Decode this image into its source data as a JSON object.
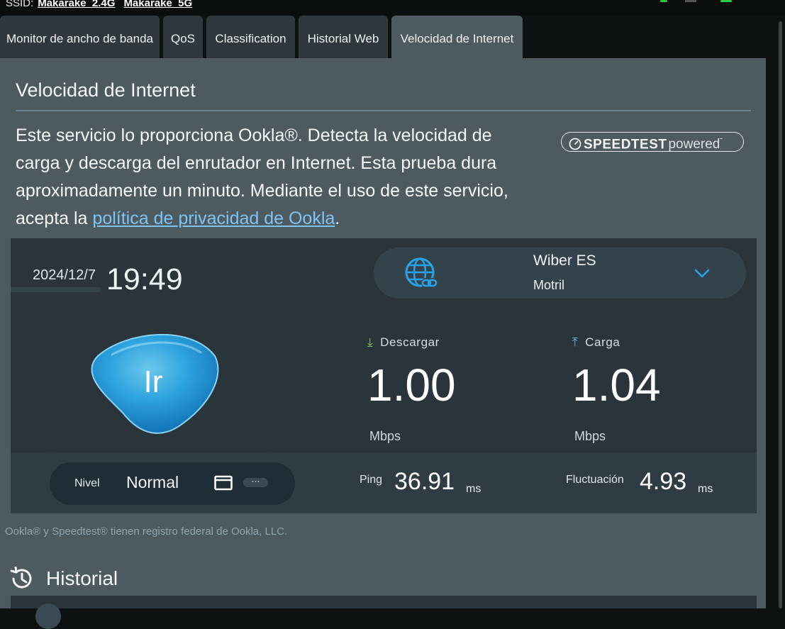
{
  "header": {
    "ssid_label": "SSID:",
    "networks": [
      "Makarake_2.4G",
      "Makarake_5G"
    ]
  },
  "tabs": [
    {
      "label": "Monitor de ancho de banda",
      "active": false
    },
    {
      "label": "QoS",
      "active": false
    },
    {
      "label": "Classification",
      "active": false
    },
    {
      "label": "Historial Web",
      "active": false
    },
    {
      "label": "Velocidad de Internet",
      "active": true
    }
  ],
  "page": {
    "title": "Velocidad de Internet",
    "description_prefix": "Este servicio lo proporciona Ookla®. Detecta la velocidad de carga y descarga del enrutador en Internet. Esta prueba dura aproximadamente un minuto. Mediante el uso de este servicio, acepta la ",
    "privacy_link": "política de privacidad de Ookla",
    "description_suffix": ".",
    "badge": {
      "brand": "SPEEDTEST",
      "suffix": "powered",
      "mark": "˜"
    }
  },
  "test": {
    "date": "2024/12/7",
    "time": "19:49",
    "server_name": "Wiber ES",
    "server_city": "Motril",
    "go_label": "Ir",
    "download_label": "Descargar",
    "download_value": "1.00",
    "download_unit": "Mbps",
    "upload_label": "Carga",
    "upload_value": "1.04",
    "upload_unit": "Mbps",
    "level_label": "Nivel",
    "level_value": "Normal",
    "more_label": "···",
    "ping_label": "Ping",
    "ping_value": "36.91",
    "ping_unit": "ms",
    "jitter_label": "Fluctuación",
    "jitter_value": "4.93",
    "jitter_unit": "ms"
  },
  "legal": "Ookla® y Speedtest® tienen registro federal de Ookla, LLC.",
  "history": {
    "title": "Historial"
  },
  "colors": {
    "accent_blue": "#29a3e8",
    "link": "#7fc4f3",
    "download_arrow": "#7ec86a",
    "upload_arrow": "#5fb4e6"
  }
}
